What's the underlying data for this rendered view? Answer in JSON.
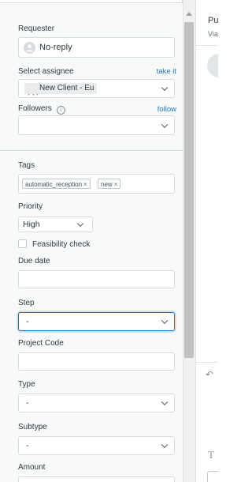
{
  "requester": {
    "label": "Requester",
    "value": "No-reply"
  },
  "assignee": {
    "label": "Select assignee",
    "take_it": "take it",
    "value": "New Client - Eu"
  },
  "followers": {
    "label": "Followers",
    "follow": "follow",
    "info_icon": "i"
  },
  "tags": {
    "label": "Tags",
    "items": [
      {
        "label": "automatic_reception",
        "remove": "×"
      },
      {
        "label": "new",
        "remove": "×"
      }
    ]
  },
  "priority": {
    "label": "Priority",
    "value": "High"
  },
  "feasibility": {
    "label": "Feasibility check",
    "checked": false
  },
  "due_date": {
    "label": "Due date",
    "value": ""
  },
  "step": {
    "label": "Step",
    "value": "-"
  },
  "project_code": {
    "label": "Project Code",
    "value": ""
  },
  "type": {
    "label": "Type",
    "value": "-"
  },
  "subtype": {
    "label": "Subtype",
    "value": "-"
  },
  "amount": {
    "label": "Amount"
  },
  "right_panel": {
    "title": "Pu",
    "subtitle": "Via",
    "reply_icon": "↶",
    "text_icon": "T"
  },
  "colors": {
    "accent": "#1f73b7",
    "focus_border": "#1f73b7",
    "panel_bg": "#f8f9f9"
  }
}
